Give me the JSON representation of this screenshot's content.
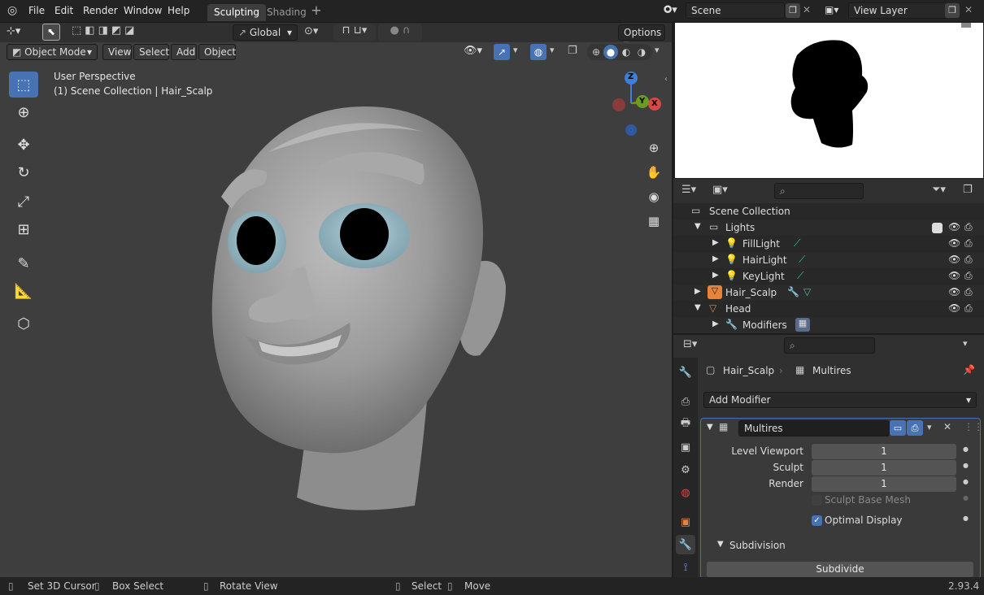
{
  "menu": {
    "file": "File",
    "edit": "Edit",
    "render": "Render",
    "window": "Window",
    "help": "Help"
  },
  "workspaces": {
    "active": "Sculpting",
    "inactive": "Shading",
    "add": "+"
  },
  "scene": {
    "name": "Scene",
    "view_layer": "View Layer"
  },
  "tool_header": {
    "orientation": "Global",
    "options": "Options"
  },
  "viewport_header": {
    "mode": "Object Mode",
    "view": "View",
    "select": "Select",
    "add": "Add",
    "object": "Object"
  },
  "viewport": {
    "perspective": "User Perspective",
    "collection_info": "(1) Scene Collection | Hair_Scalp",
    "gizmo": {
      "z": "Z",
      "y": "Y",
      "x": "X"
    }
  },
  "outliner": {
    "rows": [
      {
        "label": "Scene Collection"
      },
      {
        "label": "Lights"
      },
      {
        "label": "FillLight"
      },
      {
        "label": "HairLight"
      },
      {
        "label": "KeyLight"
      },
      {
        "label": "Hair_Scalp"
      },
      {
        "label": "Head"
      },
      {
        "label": "Modifiers"
      }
    ]
  },
  "properties": {
    "breadcrumb_object": "Hair_Scalp",
    "breadcrumb_modifier": "Multires",
    "add_modifier": "Add Modifier",
    "modifier_name": "Multires",
    "level_viewport_label": "Level Viewport",
    "level_viewport": "1",
    "sculpt_label": "Sculpt",
    "sculpt": "1",
    "render_label": "Render",
    "render": "1",
    "sculpt_base_mesh": "Sculpt Base Mesh",
    "optimal_display": "Optimal Display",
    "optimal_display_checked": true,
    "subdivision": "Subdivision",
    "subdivide": "Subdivide"
  },
  "status": {
    "set_cursor": "Set 3D Cursor",
    "box_select": "Box Select",
    "rotate_view": "Rotate View",
    "select": "Select",
    "move": "Move",
    "version": "2.93.4"
  },
  "colors": {
    "accent": "#4772b3",
    "gizmo_x": "#d84848",
    "gizmo_y": "#6a9c1f",
    "gizmo_z": "#3f7fd7"
  }
}
